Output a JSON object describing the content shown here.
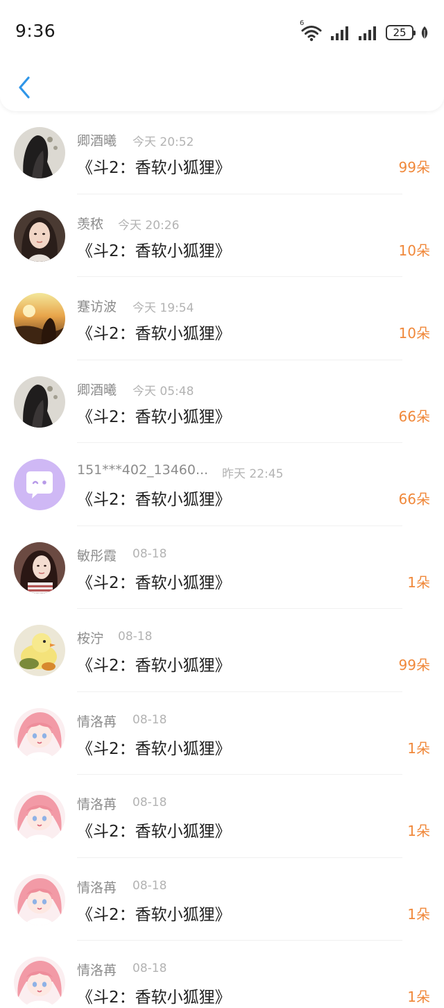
{
  "status_bar": {
    "time": "9:36",
    "battery": "25",
    "network_badge": "6"
  },
  "colors": {
    "accent_back": "#2f96e8",
    "amount": "#f0883a",
    "username": "#8c8c8c",
    "timestamp": "#b3b3b3",
    "title": "#222222"
  },
  "list": {
    "rows": [
      {
        "username": "卿酒曦",
        "time": "今天 20:52",
        "title": "《斗2：香软小狐狸》",
        "amount": "99朵",
        "avatar": "dark-hair-photo"
      },
      {
        "username": "羡秾",
        "time": "今天 20:26",
        "title": "《斗2：香软小狐狸》",
        "amount": "10朵",
        "avatar": "portrait-photo"
      },
      {
        "username": "蹇访波",
        "time": "今天 19:54",
        "title": "《斗2：香软小狐狸》",
        "amount": "10朵",
        "avatar": "sunset-photo"
      },
      {
        "username": "卿酒曦",
        "time": "今天 05:48",
        "title": "《斗2：香软小狐狸》",
        "amount": "66朵",
        "avatar": "dark-hair-photo"
      },
      {
        "username": "151***402_13460...",
        "time": "昨天 22:45",
        "title": "《斗2：香软小狐狸》",
        "amount": "66朵",
        "avatar": "default-chat-avatar"
      },
      {
        "username": "敏彤霞",
        "time": "08-18",
        "title": "《斗2：香软小狐狸》",
        "amount": "1朵",
        "avatar": "girl-photo"
      },
      {
        "username": "桉泞",
        "time": "08-18",
        "title": "《斗2：香软小狐狸》",
        "amount": "99朵",
        "avatar": "duck-toy-photo"
      },
      {
        "username": "情洛苒",
        "time": "08-18",
        "title": "《斗2：香软小狐狸》",
        "amount": "1朵",
        "avatar": "anime-girl-pink"
      },
      {
        "username": "情洛苒",
        "time": "08-18",
        "title": "《斗2：香软小狐狸》",
        "amount": "1朵",
        "avatar": "anime-girl-pink"
      },
      {
        "username": "情洛苒",
        "time": "08-18",
        "title": "《斗2：香软小狐狸》",
        "amount": "1朵",
        "avatar": "anime-girl-pink"
      },
      {
        "username": "情洛苒",
        "time": "08-18",
        "title": "《斗2：香软小狐狸》",
        "amount": "1朵",
        "avatar": "anime-girl-pink"
      }
    ]
  }
}
